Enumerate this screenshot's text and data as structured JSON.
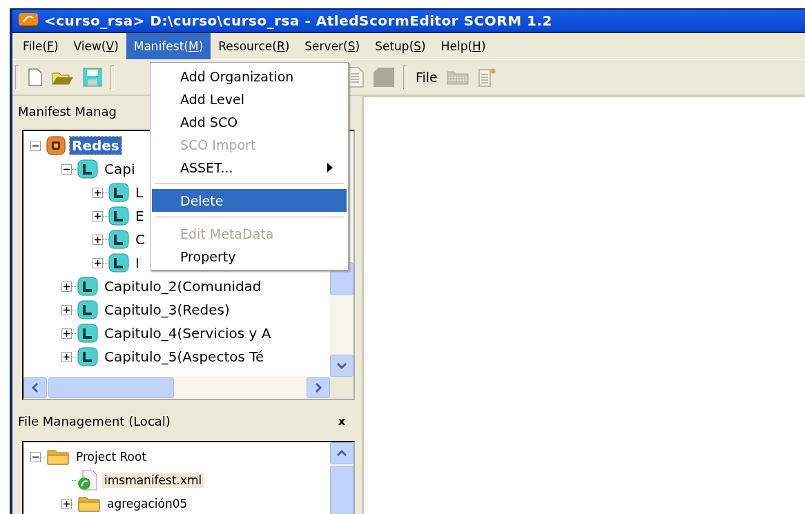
{
  "window": {
    "title": "<curso_rsa> D:\\curso\\curso_rsa - AtledScormEditor SCORM 1.2"
  },
  "menu_bar": [
    {
      "text": [
        "File(",
        "F",
        ")"
      ],
      "selected": false
    },
    {
      "text": [
        "View(",
        "V",
        ")"
      ],
      "selected": false
    },
    {
      "text": [
        "Manifest(",
        "M",
        ")"
      ],
      "selected": true
    },
    {
      "text": [
        "Resource(",
        "R",
        ")"
      ],
      "selected": false
    },
    {
      "text": [
        "Server(",
        "S",
        ")"
      ],
      "selected": false
    },
    {
      "text": [
        "Setup(",
        "S",
        ")"
      ],
      "selected": false
    },
    {
      "text": [
        "Help(",
        "H",
        ")"
      ],
      "selected": false
    }
  ],
  "toolbar": {
    "label": "File"
  },
  "manifest_panel": {
    "title": "Manifest Manag",
    "tree": [
      {
        "label": "Redes",
        "kind": "org",
        "selected": true,
        "expanded": true,
        "children": [
          {
            "label": "Capi",
            "kind": "level",
            "selected": false,
            "expanded": true,
            "children": [
              {
                "label": "L",
                "kind": "level",
                "selected": false,
                "expanded": false
              },
              {
                "label": "E",
                "kind": "level",
                "selected": false,
                "expanded": false
              },
              {
                "label": "C",
                "kind": "level",
                "selected": false,
                "expanded": false
              },
              {
                "label": "I",
                "kind": "level",
                "selected": false,
                "expanded": false
              }
            ]
          },
          {
            "label": "Capitulo_2(Comunidad",
            "kind": "level",
            "selected": false,
            "expanded": false
          },
          {
            "label": "Capitulo_3(Redes)",
            "kind": "level",
            "selected": false,
            "expanded": false
          },
          {
            "label": "Capitulo_4(Servicios y A",
            "kind": "level",
            "selected": false,
            "expanded": false
          },
          {
            "label": "Capitulo_5(Aspectos Té",
            "kind": "level",
            "selected": false,
            "expanded": false
          }
        ]
      }
    ]
  },
  "dropdown_menu": [
    {
      "kind": "item",
      "label": "Add Organization",
      "disabled": false,
      "selected": false,
      "submenu": false
    },
    {
      "kind": "item",
      "label": "Add Level",
      "disabled": false,
      "selected": false,
      "submenu": false
    },
    {
      "kind": "item",
      "label": "Add SCO",
      "disabled": false,
      "selected": false,
      "submenu": false
    },
    {
      "kind": "item",
      "label": "SCO Import",
      "disabled": true,
      "selected": false,
      "submenu": false
    },
    {
      "kind": "item",
      "label": "ASSET...",
      "disabled": false,
      "selected": false,
      "submenu": true
    },
    {
      "kind": "separator"
    },
    {
      "kind": "item",
      "label": "Delete",
      "disabled": false,
      "selected": true,
      "submenu": false
    },
    {
      "kind": "separator"
    },
    {
      "kind": "item",
      "label": "Edit MetaData",
      "disabled": true,
      "selected": false,
      "submenu": false
    },
    {
      "kind": "item",
      "label": "Property",
      "disabled": false,
      "selected": false,
      "submenu": false
    }
  ],
  "file_panel": {
    "title": "File Management (Local)",
    "close": "x",
    "tree": [
      {
        "label": "Project Root",
        "kind": "folder",
        "selected": false,
        "expanded": true,
        "children": [
          {
            "label": "imsmanifest.xml",
            "kind": "file",
            "selected": true
          },
          {
            "label": "agregación05",
            "kind": "folder",
            "selected": false,
            "expanded": false
          }
        ]
      }
    ]
  }
}
